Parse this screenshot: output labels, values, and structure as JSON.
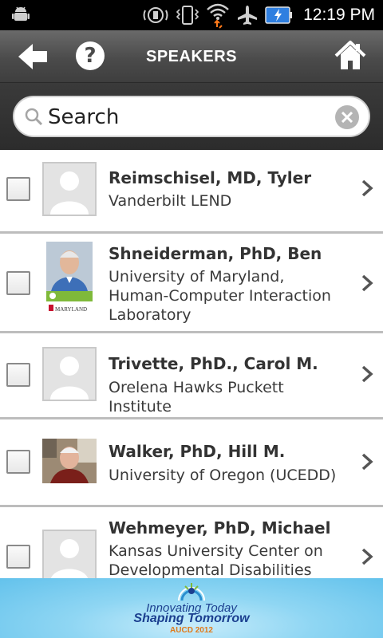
{
  "status_bar": {
    "time": "12:19 PM",
    "icons": [
      "android-debug-icon",
      "vibrate-icon",
      "phone-vibrate-icon",
      "wifi-icon",
      "airplane-icon",
      "battery-charging-icon"
    ]
  },
  "header": {
    "title": "SPEAKERS",
    "help_label": "?"
  },
  "search": {
    "placeholder": "Search",
    "value": ""
  },
  "speakers": [
    {
      "name": "Reimschisel, MD, Tyler",
      "org": "Vanderbilt LEND",
      "photo": "placeholder",
      "checked": false
    },
    {
      "name": "Shneiderman, PhD, Ben",
      "org": "University of Maryland, Human-Computer Interaction Laboratory",
      "photo": "portrait",
      "checked": false
    },
    {
      "name": "Trivette, PhD., Carol M.",
      "org": "Orelena Hawks Puckett Institute",
      "photo": "placeholder",
      "checked": false
    },
    {
      "name": "Walker, PhD, Hill M.",
      "org": "University of Oregon (UCEDD)",
      "photo": "portrait",
      "checked": false
    },
    {
      "name": "Wehmeyer, PhD, Michael",
      "org": "Kansas University Center on Developmental Disabilities",
      "photo": "placeholder",
      "checked": false
    }
  ],
  "photo_text": {
    "maryland_card": "MARYLAND"
  },
  "banner": {
    "line1": "Innovating Today",
    "line2": "Shaping Tomorrow",
    "line3": "AUCD 2012"
  },
  "colors": {
    "titlebar": "#4b4b4b",
    "banner": "#8fd6f3",
    "banner_text": "#1b3f8f",
    "banner_accent": "#e07a1a"
  }
}
